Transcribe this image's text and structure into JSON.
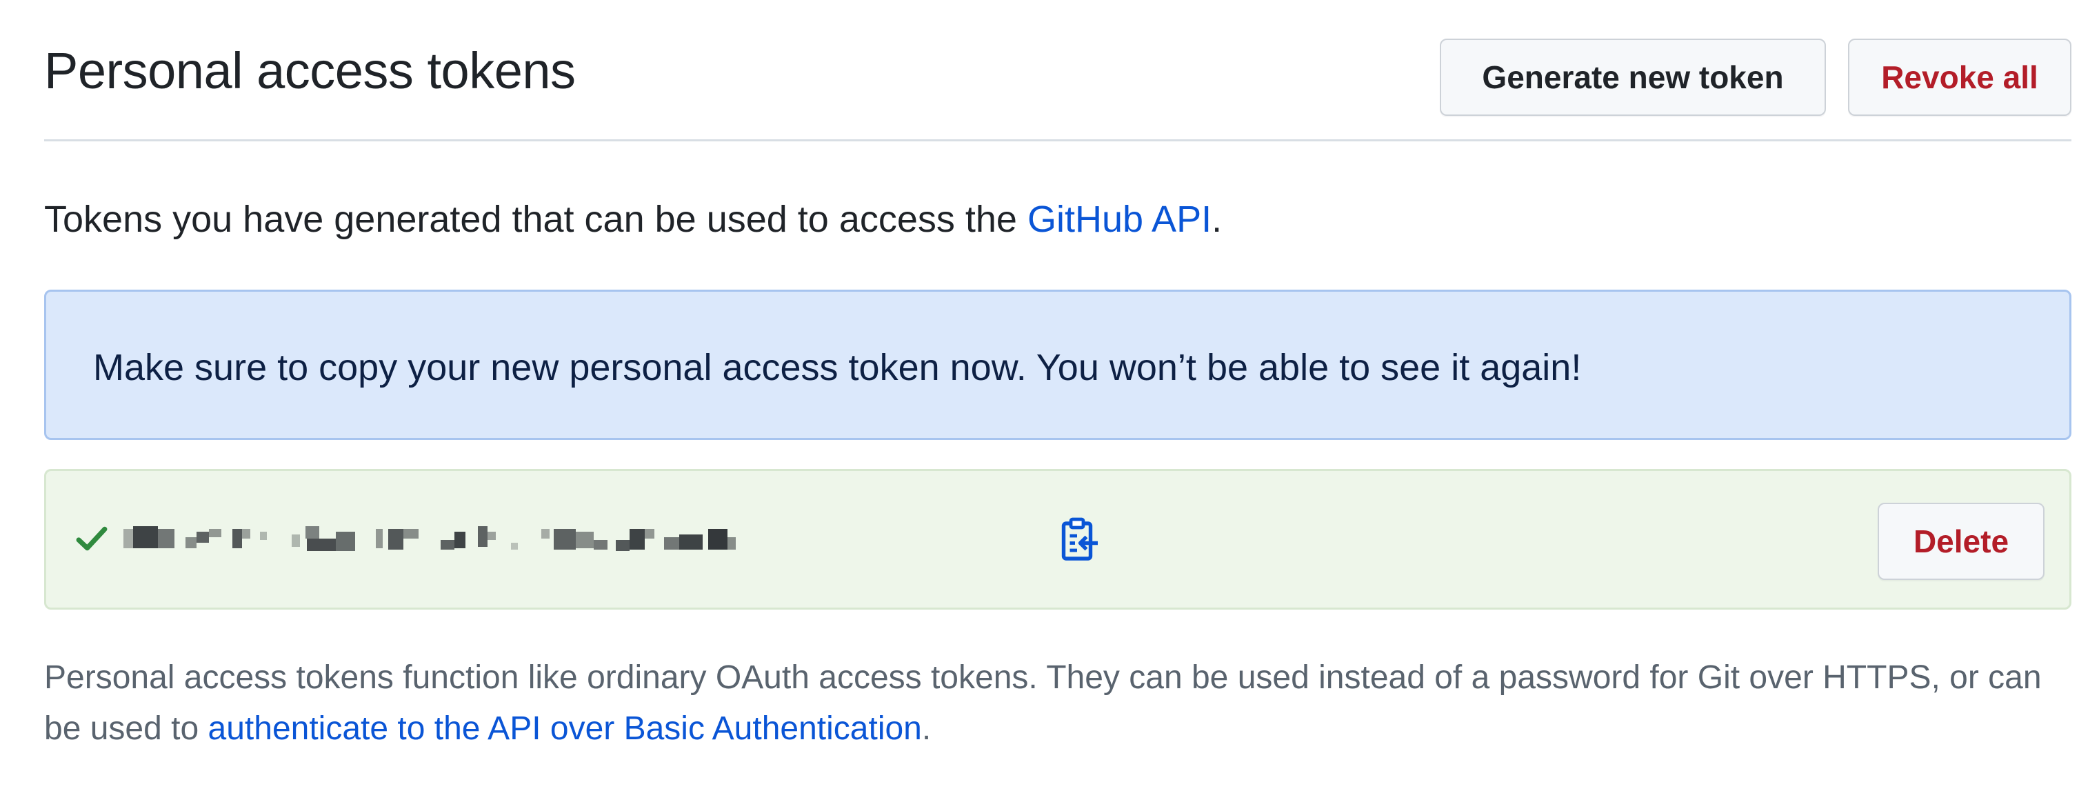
{
  "header": {
    "title": "Personal access tokens",
    "generate_label": "Generate new token",
    "revoke_label": "Revoke all"
  },
  "intro": {
    "text_before": "Tokens you have generated that can be used to access the ",
    "link_text": "GitHub API",
    "text_after": "."
  },
  "flash": {
    "message": "Make sure to copy your new personal access token now. You won’t be able to see it again!"
  },
  "token_row": {
    "status_icon": "check-icon",
    "copy_icon": "clipboard-copy-icon",
    "delete_label": "Delete"
  },
  "footnote": {
    "text_before": "Personal access tokens function like ordinary OAuth access tokens. They can be used instead of a password for Git over HTTPS, or can be used to ",
    "link_text": "authenticate to the API over Basic Authentication",
    "text_after": "."
  },
  "colors": {
    "link": "#0a55d6",
    "danger": "#b31d28",
    "success": "#2f8a3e",
    "flash_bg": "#dbe8fb",
    "token_bg": "#eef6ea"
  }
}
